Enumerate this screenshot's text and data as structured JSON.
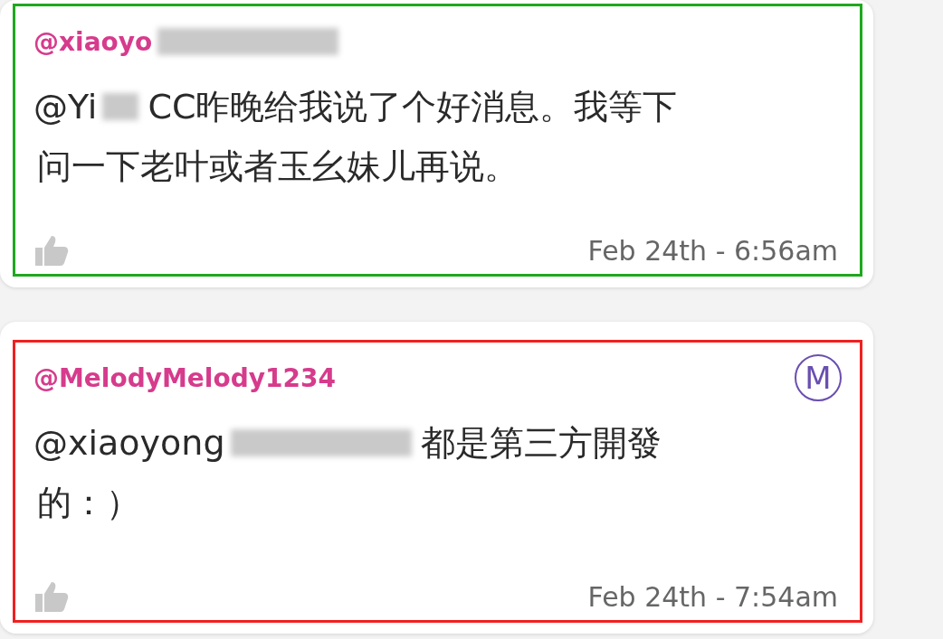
{
  "comments": [
    {
      "username": "@xiaoyo",
      "username_blurred": true,
      "mention": "@Yi",
      "mention_blurred": true,
      "lines": [
        "CC昨晚给我说了个好消息。我等下",
        "问一下老叶或者玉幺妹儿再说。"
      ],
      "timestamp": "Feb 24th - 6:56am",
      "color": "#1fa81f"
    },
    {
      "username": "@MelodyMelody1234",
      "badge": "M",
      "mention": "@xiaoyong",
      "mention_blurred": true,
      "lines": [
        "都是第三方開發",
        "的：）"
      ],
      "timestamp": "Feb 24th - 7:54am",
      "color": "#f02020"
    }
  ]
}
